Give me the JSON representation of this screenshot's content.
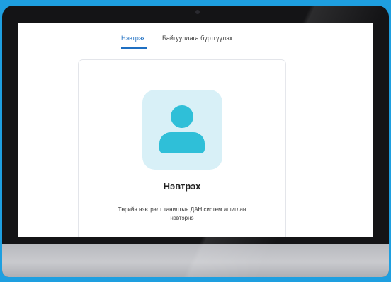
{
  "tabs": [
    {
      "label": "Нэвтрэх",
      "active": true
    },
    {
      "label": "Байгууллага бүртгүүлэх",
      "active": false
    }
  ],
  "login_card": {
    "icon": "user-avatar-icon",
    "title": "Нэвтрэх",
    "description": "Төрийн нэвтрэлт танилтын ДАН систем ашиглан нэвтэрнэ"
  },
  "colors": {
    "accent": "#1e6fc2",
    "icon": "#2fbfd8",
    "icon_background": "#d8f0f7"
  }
}
